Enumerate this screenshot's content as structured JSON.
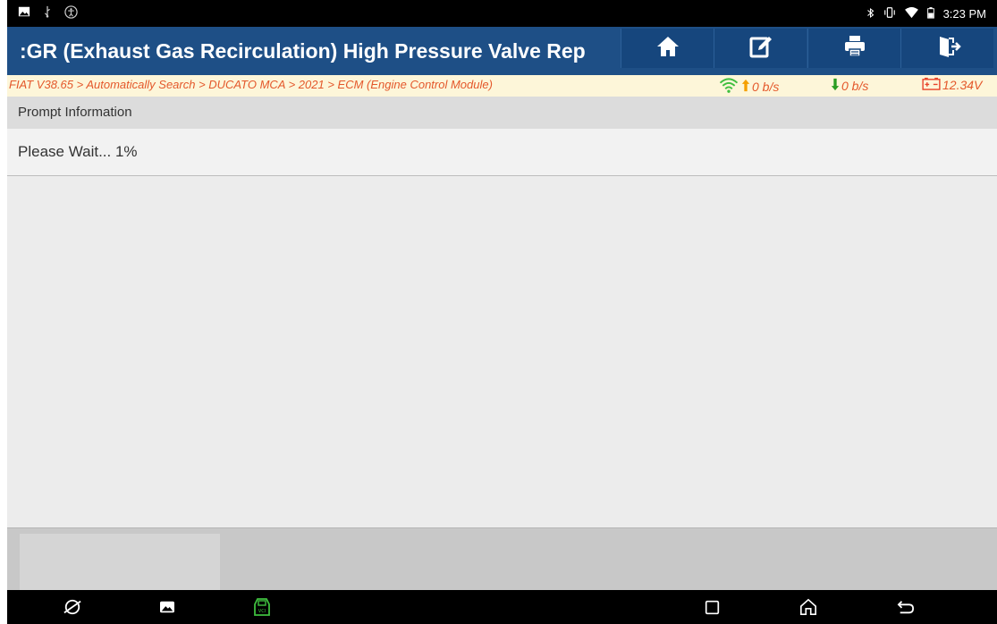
{
  "status_bar": {
    "time": "3:23 PM",
    "left_icons": [
      "image-icon",
      "usb-icon",
      "accessibility-icon"
    ],
    "right_icons": [
      "bluetooth-icon",
      "vibrate-icon",
      "wifi-icon",
      "battery-icon"
    ]
  },
  "header": {
    "title": ":GR (Exhaust Gas Recirculation) High Pressure Valve Rep",
    "buttons": [
      {
        "icon": "home-icon"
      },
      {
        "icon": "edit-report-icon"
      },
      {
        "icon": "print-icon"
      },
      {
        "icon": "exit-icon"
      }
    ]
  },
  "breadcrumb": {
    "path": "FIAT V38.65 > Automatically Search > DUCATO MCA > 2021 > ECM (Engine Control Module)",
    "upload_rate": "0 b/s",
    "download_rate": "0 b/s",
    "voltage": "12.34V"
  },
  "main": {
    "section_title": "Prompt Information",
    "message": "Please Wait... 1%",
    "progress_percent": 1
  },
  "nav_bar": {
    "left_icons": [
      "browser-icon",
      "gallery-icon",
      "vci-icon"
    ],
    "right_icons": [
      "recents-icon",
      "home-nav-icon",
      "back-icon"
    ]
  },
  "colors": {
    "header_bg": "#1e4f86",
    "breadcrumb_text": "#e4582b",
    "breadcrumb_bg": "#fdf6d9",
    "upload_arrow": "#f5a000",
    "download_arrow": "#2a9d22",
    "battery": "#e8442a",
    "vci_icon": "#3fbf3f"
  }
}
